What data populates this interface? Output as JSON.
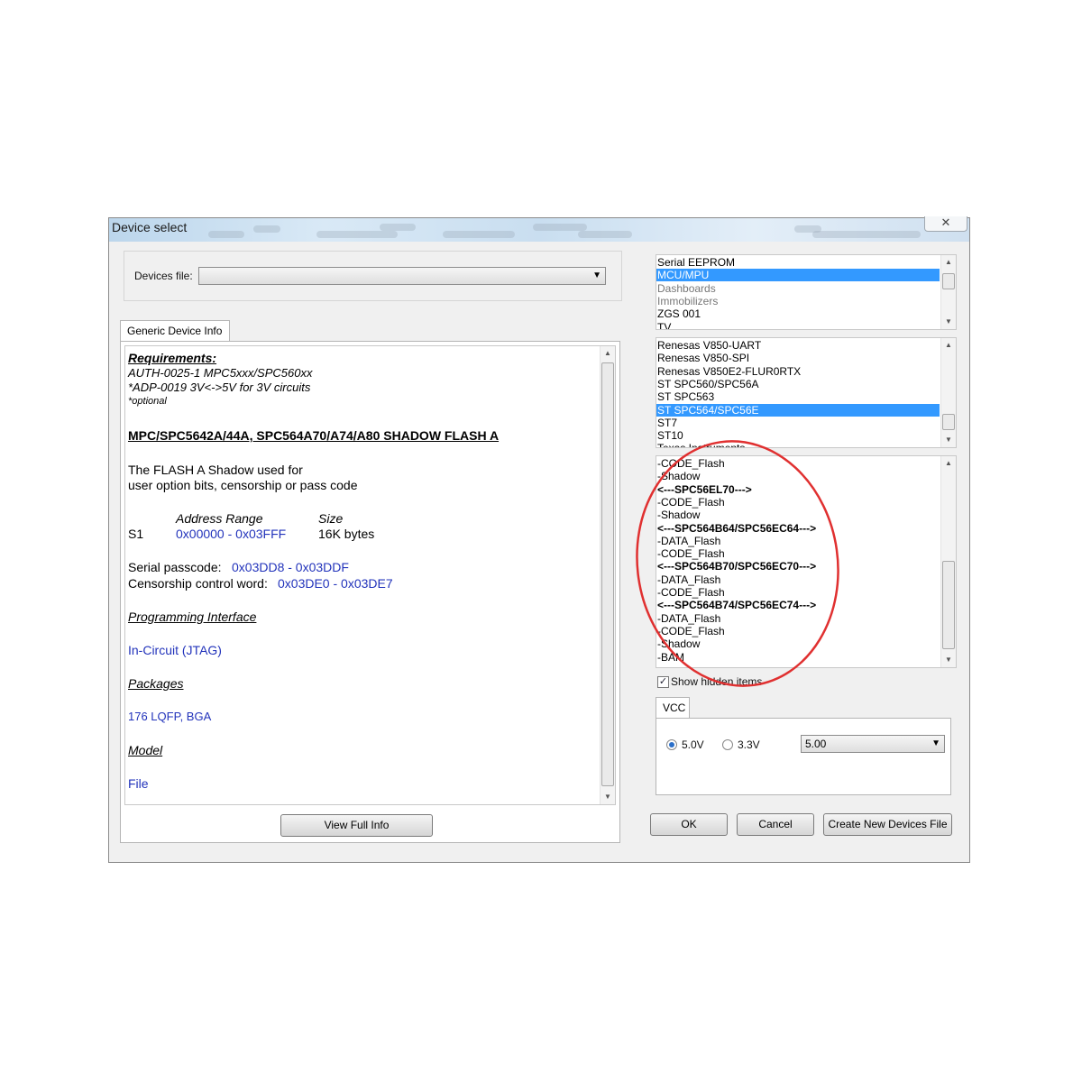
{
  "window": {
    "title": "Device select",
    "close_label": "✕",
    "accent": "#3399ff",
    "link_color": "#2233bb"
  },
  "devices_file": {
    "label": "Devices file:",
    "value": ""
  },
  "tab": {
    "label": "Generic Device Info"
  },
  "info": {
    "requirements_heading": "Requirements:",
    "req1": "AUTH-0025-1 MPC5xxx/SPC560xx",
    "req2": "*ADP-0019 3V<->5V for 3V circuits",
    "req3": "*optional",
    "device_title": "MPC/SPC5642A/44A, SPC564A70/A74/A80 SHADOW FLASH A",
    "desc1": "The FLASH A Shadow used for",
    "desc2": "user option bits, censorship or pass code",
    "addr_header": "Address Range",
    "size_header": "Size",
    "s1_label": "S1",
    "s1_range": "0x00000 - 0x03FFF",
    "s1_size": "16K bytes",
    "passcode_label": "Serial passcode:",
    "passcode_value": "0x03DD8 - 0x03DDF",
    "censor_label": "Censorship control word:",
    "censor_value": "0x03DE0 - 0x03DE7",
    "prog_heading": "Programming Interface",
    "prog_value": "In-Circuit (JTAG)",
    "packages_heading": "Packages",
    "packages_value": "176 LQFP, BGA",
    "model_heading": "Model",
    "file_link": "File"
  },
  "buttons": {
    "view_full_info": "View Full Info",
    "ok": "OK",
    "cancel": "Cancel",
    "create_new": "Create New Devices File"
  },
  "category_list": [
    {
      "label": "Serial EEPROM",
      "state": "normal"
    },
    {
      "label": "MCU/MPU",
      "state": "selected"
    },
    {
      "label": "Dashboards",
      "state": "dim"
    },
    {
      "label": "Immobilizers",
      "state": "dim"
    },
    {
      "label": "ZGS 001",
      "state": "normal"
    },
    {
      "label": "TV",
      "state": "normal"
    }
  ],
  "family_list": [
    {
      "label": "Renesas V850-UART",
      "state": "normal"
    },
    {
      "label": "Renesas V850-SPI",
      "state": "normal"
    },
    {
      "label": "Renesas V850E2-FLUR0RTX",
      "state": "normal"
    },
    {
      "label": "ST SPC560/SPC56A",
      "state": "normal"
    },
    {
      "label": "ST SPC563",
      "state": "normal"
    },
    {
      "label": "ST SPC564/SPC56E",
      "state": "selected"
    },
    {
      "label": "ST7",
      "state": "normal"
    },
    {
      "label": "ST10",
      "state": "normal"
    },
    {
      "label": "Texas Instruments",
      "state": "normal"
    }
  ],
  "memory_list": [
    {
      "label": "-CODE_Flash",
      "bold": false
    },
    {
      "label": "-Shadow",
      "bold": false
    },
    {
      "label": "<---SPC56EL70--->",
      "bold": true
    },
    {
      "label": "-CODE_Flash",
      "bold": false
    },
    {
      "label": "-Shadow",
      "bold": false
    },
    {
      "label": "<---SPC564B64/SPC56EC64--->",
      "bold": true
    },
    {
      "label": "-DATA_Flash",
      "bold": false
    },
    {
      "label": "-CODE_Flash",
      "bold": false
    },
    {
      "label": "<---SPC564B70/SPC56EC70--->",
      "bold": true
    },
    {
      "label": "-DATA_Flash",
      "bold": false
    },
    {
      "label": "-CODE_Flash",
      "bold": false
    },
    {
      "label": "<---SPC564B74/SPC56EC74--->",
      "bold": true
    },
    {
      "label": "-DATA_Flash",
      "bold": false
    },
    {
      "label": "-CODE_Flash",
      "bold": false
    },
    {
      "label": "-Shadow",
      "bold": false
    },
    {
      "label": "-BAM",
      "bold": false
    }
  ],
  "show_hidden": {
    "label": "Show hidden items",
    "checked": true
  },
  "vcc": {
    "group_label": "VCC",
    "opt1": "5.0V",
    "opt2": "3.3V",
    "selected": "5.0V",
    "combo_value": "5.00"
  },
  "annotation": {
    "color": "#e03030"
  }
}
